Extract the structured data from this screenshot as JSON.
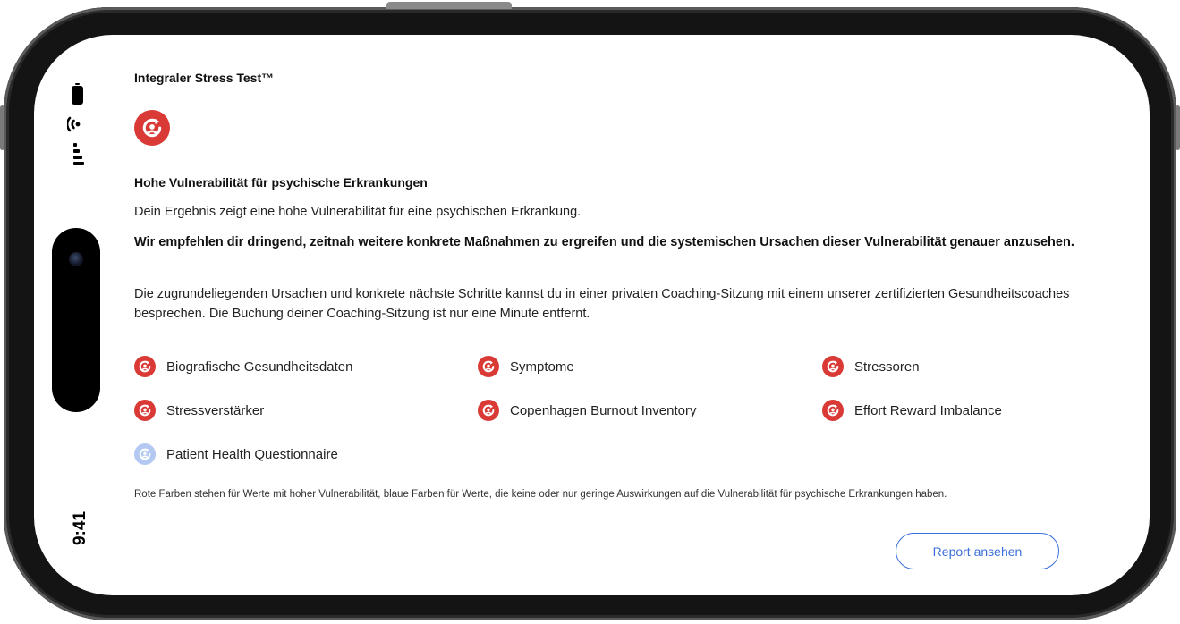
{
  "status_bar": {
    "time": "9:41"
  },
  "card": {
    "title": "Integraler Stress Test™",
    "result_icon": "red-cycle-icon",
    "heading": "Hohe Vulnerabilität für psychische Erkrankungen",
    "summary": "Dein Ergebnis zeigt eine hohe Vulnerabilität für eine psychischen Erkrankung.",
    "recommendation": "Wir empfehlen dir dringend, zeitnah weitere konkrete Maßnahmen zu ergreifen und die systemischen Ursachen dieser Vulnerabilität genauer anzusehen.",
    "details": "Die zugrundeliegenden Ursachen und konkrete nächste Schritte kannst du in einer privaten Coaching-Sitzung mit einem unserer zertifizierten Gesundheitscoaches besprechen. Die Buchung deiner Coaching-Sitzung ist nur eine Minute entfernt.",
    "categories": [
      {
        "label": "Biografische Gesundheitsdaten",
        "status": "red"
      },
      {
        "label": "Symptome",
        "status": "red"
      },
      {
        "label": "Stressoren",
        "status": "red"
      },
      {
        "label": "Stressverstärker",
        "status": "red"
      },
      {
        "label": "Copenhagen Burnout Inventory",
        "status": "red"
      },
      {
        "label": "Effort Reward Imbalance",
        "status": "red"
      },
      {
        "label": "Patient Health Questionnaire",
        "status": "blue"
      }
    ],
    "footnote": "Rote Farben stehen für Werte mit hoher Vulnerabilität, blaue Farben für Werte, die keine oder nur geringe Auswirkungen auf die Vulnerabilität für psychische Erkrankungen haben.",
    "report_button": "Report ansehen"
  },
  "colors": {
    "high": "#d93a36",
    "low": "#b3c8f2",
    "accent": "#3a6fd8"
  }
}
